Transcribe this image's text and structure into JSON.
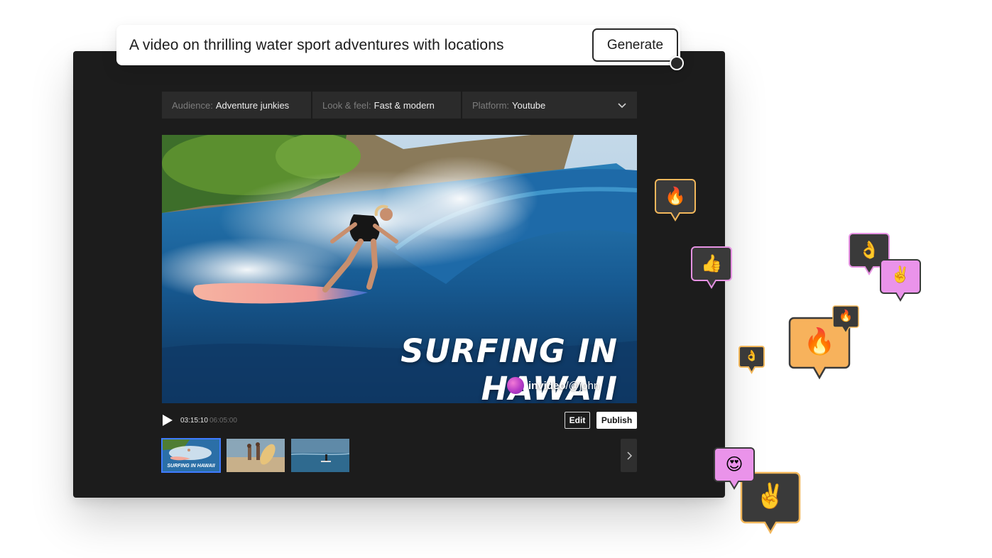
{
  "prompt": {
    "text": "A video on thrilling water sport adventures with locations",
    "generate_label": "Generate"
  },
  "settings": [
    {
      "key": "Audience:",
      "value": "Adventure junkies"
    },
    {
      "key": "Look & feel:",
      "value": "Fast & modern"
    },
    {
      "key": "Platform:",
      "value": "Youtube"
    }
  ],
  "video": {
    "title": "SURFING IN HAWAII",
    "brand_name": "invideo",
    "brand_handle": "/@john"
  },
  "player": {
    "current_time": "03:15:10",
    "total_time": "06:05:00",
    "edit_label": "Edit",
    "publish_label": "Publish"
  },
  "thumbnails": [
    {
      "label": "SURFING IN HAWAII"
    },
    {
      "label": ""
    },
    {
      "label": ""
    }
  ],
  "reactions": [
    {
      "emoji": "🔥",
      "bg": "#3a3a3a",
      "border": "#f2b75b"
    },
    {
      "emoji": "👍",
      "bg": "#3a3a3a",
      "border": "#e692e3"
    },
    {
      "emoji": "👌",
      "bg": "#3a3a3a",
      "border": "#e692e3"
    },
    {
      "emoji": "✌️",
      "bg": "#ea93ea",
      "border": "#3a3a3a"
    },
    {
      "emoji": "👌",
      "bg": "#3a3a3a",
      "border": "#f2b75b"
    },
    {
      "emoji": "🔥",
      "bg": "#f7b25c",
      "border": "#3a3a3a"
    },
    {
      "emoji": "🔥",
      "bg": "#3a3a3a",
      "border": "#f2b75b"
    },
    {
      "emoji": "😍",
      "bg": "#ea93ea",
      "border": "#3a3a3a"
    },
    {
      "emoji": "✌️",
      "bg": "#3a3a3a",
      "border": "#f2b75b"
    }
  ]
}
